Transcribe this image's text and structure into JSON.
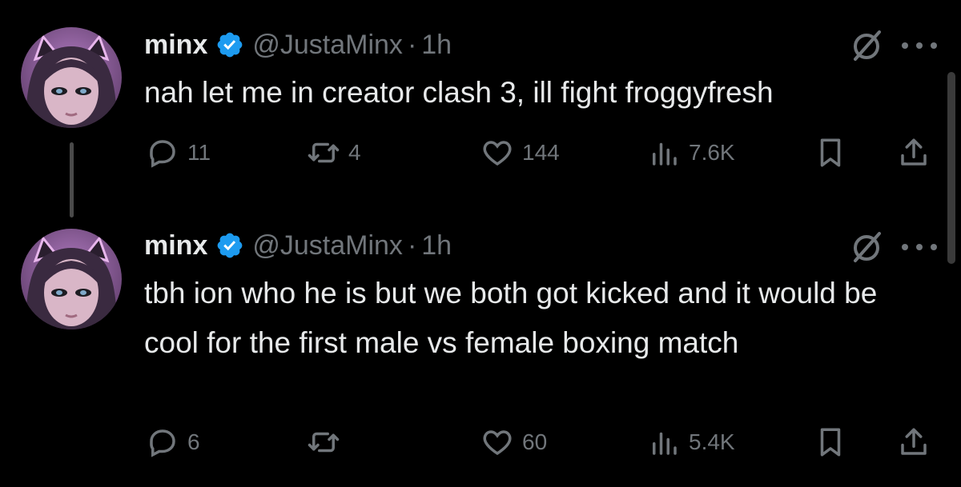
{
  "tweets": [
    {
      "display_name": "minx",
      "handle": "@JustaMinx",
      "separator": "·",
      "time": "1h",
      "text": "nah let me in creator clash 3, ill fight froggyfresh",
      "replies": "11",
      "retweets": "4",
      "likes": "144",
      "views": "7.6K"
    },
    {
      "display_name": "minx",
      "handle": "@JustaMinx",
      "separator": "·",
      "time": "1h",
      "text": "tbh ion who he is but we both got kicked and it would be cool for the first male vs female boxing match",
      "replies": "6",
      "retweets": "",
      "likes": "60",
      "views": "5.4K"
    }
  ],
  "icons": {
    "verified": "verified-badge-icon",
    "grok": "grok-icon",
    "more": "more-icon",
    "reply": "reply-icon",
    "retweet": "retweet-icon",
    "like": "like-icon",
    "views": "views-icon",
    "bookmark": "bookmark-icon",
    "share": "share-icon"
  },
  "colors": {
    "background": "#000000",
    "text_primary": "#e7e9ea",
    "text_secondary": "#71767b",
    "verified_blue": "#1d9bf0"
  }
}
